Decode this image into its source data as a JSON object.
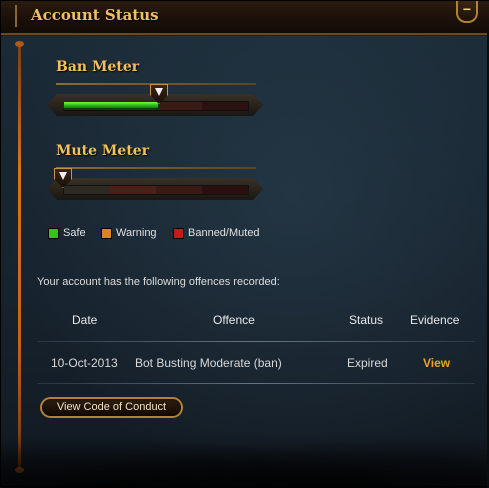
{
  "window": {
    "title": "Account Status",
    "collapse_symbol": "−"
  },
  "ban_meter": {
    "title": "Ban Meter",
    "level": 0.52
  },
  "mute_meter": {
    "title": "Mute Meter",
    "level": 0.0
  },
  "legend": [
    {
      "label": "Safe",
      "color": "#36c21f"
    },
    {
      "label": "Warning",
      "color": "#d9861a"
    },
    {
      "label": "Banned/Muted",
      "color": "#c8191a"
    }
  ],
  "offences": {
    "intro": "Your account has the following offences recorded:",
    "columns": [
      "Date",
      "Offence",
      "Status",
      "Evidence"
    ],
    "rows": [
      {
        "date": "10-Oct-2013",
        "offence": "Bot Busting Moderate (ban)",
        "status": "Expired",
        "evidence": "View"
      }
    ]
  },
  "actions": {
    "code_of_conduct": "View Code of Conduct"
  },
  "colors": {
    "accent_gold": "#f3c155",
    "link_orange": "#f0a21e",
    "meter_green": "#36c21f"
  }
}
